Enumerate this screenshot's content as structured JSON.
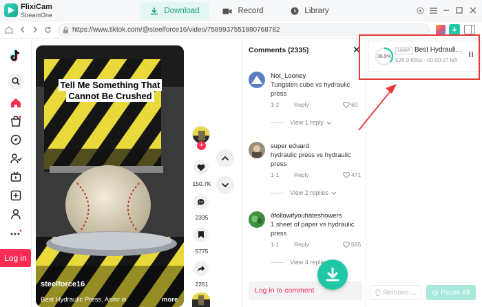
{
  "app": {
    "name": "FlixiCam",
    "subtitle": "StreamOne"
  },
  "tabs": [
    {
      "label": "Download",
      "icon": "download-icon",
      "active": true
    },
    {
      "label": "Record",
      "icon": "camera-icon",
      "active": false
    },
    {
      "label": "Library",
      "icon": "clock-icon",
      "active": false
    }
  ],
  "address": {
    "url": "https://www.tiktok.com/@steelforce16/video/7589937551880768782"
  },
  "sidebar": {
    "login_label": "Log in"
  },
  "video": {
    "caption": "Tell Me Something That Cannot Be Crushed",
    "username": "steelforce16",
    "description": "Best Hydraulic Press, Asmr is",
    "more": "more"
  },
  "actions": {
    "likes": "150.7K",
    "comments": "2335",
    "saves": "5775",
    "shares": "2251"
  },
  "comments": {
    "header": "Comments (2335)",
    "items": [
      {
        "user": "Not_Looney",
        "text": "Tungsten cube vs hydraulic press",
        "date": "1-2",
        "reply": "Reply",
        "likes": "60",
        "view_replies": "View 1 reply"
      },
      {
        "user": "super eduard",
        "text": "hydraulic press vs hydraulic press",
        "date": "1-1",
        "reply": "Reply",
        "likes": "471",
        "view_replies": "View 2 replies"
      },
      {
        "user": "ðfollowifyouhateshowers",
        "text": "1 sheet of paper vs hydraulic press",
        "date": "1-1",
        "reply": "Reply",
        "likes": "565",
        "view_replies": "View 4 replies"
      }
    ],
    "login_prompt": "Log in to comment"
  },
  "download": {
    "progress_label": "36.9%",
    "progress": 0.369,
    "resolution": "1080P",
    "title": "Best Hydraulic ...",
    "speed": "526.0 KB/s - 00:00:07 left",
    "remove_label": "Remove ...",
    "pause_all_label": "Pause All"
  },
  "colors": {
    "accent": "#1fc7a6",
    "tiktok_red": "#fe2c55",
    "annotation": "#e53935"
  }
}
